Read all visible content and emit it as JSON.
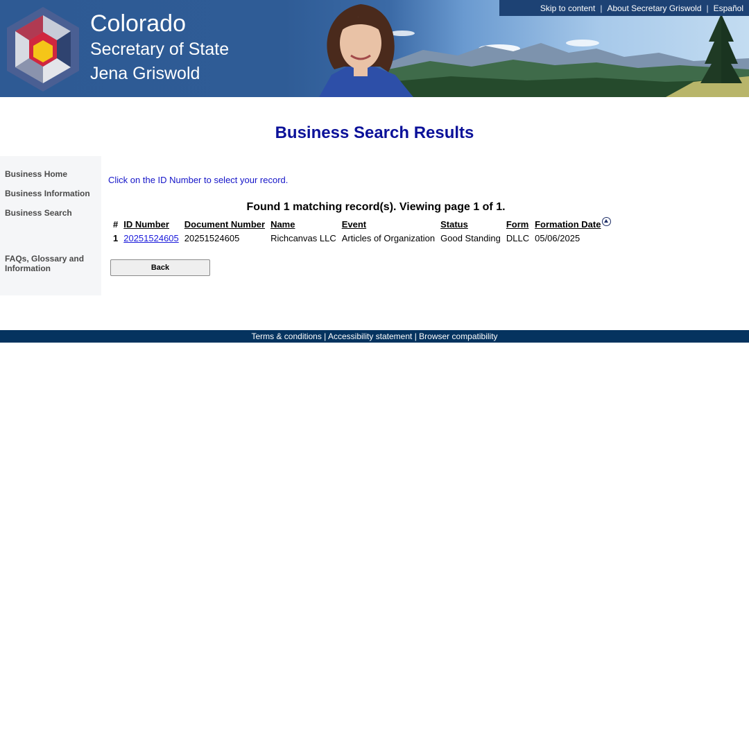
{
  "header": {
    "title_line1": "Colorado",
    "title_line2": "Secretary of State",
    "title_line3": "Jena Griswold",
    "top_links": [
      "Skip to content",
      "About Secretary Griswold",
      "Español"
    ],
    "separator": "|"
  },
  "page_title": "Business Search Results",
  "sidebar": {
    "items": [
      {
        "label": "Business Home"
      },
      {
        "label": "Business Information"
      },
      {
        "label": "Business Search"
      },
      {
        "label": "FAQs, Glossary and Information"
      }
    ]
  },
  "main": {
    "instruction": "Click on the ID Number to select your record.",
    "found_text": "Found 1 matching record(s).  Viewing page 1 of 1.",
    "table": {
      "headers": [
        "#",
        "ID Number",
        "Document Number",
        "Name",
        "Event",
        "Status",
        "Form",
        "Formation Date"
      ],
      "rows": [
        {
          "num": "1",
          "id_number": "20251524605",
          "document_number": "20251524605",
          "name": "Richcanvas LLC",
          "event": "Articles of Organization",
          "status": "Good Standing",
          "form": "DLLC",
          "formation_date": "05/06/2025"
        }
      ],
      "sort_icon": "sort-ascending-icon"
    },
    "back_button": "Back"
  },
  "footer": {
    "links": [
      "Terms & conditions",
      "Accessibility statement",
      "Browser compatibility"
    ],
    "separator": "|"
  },
  "colors": {
    "banner_blue": "#2f5c96",
    "title_blue": "#0b1199",
    "link_blue": "#1a1adb",
    "footer_navy": "#05335f"
  }
}
